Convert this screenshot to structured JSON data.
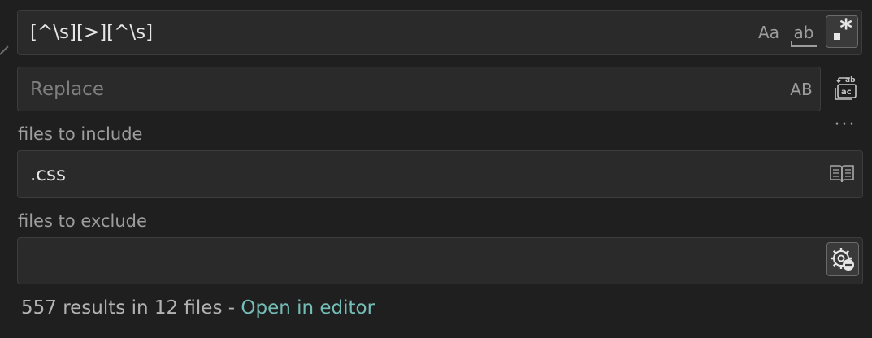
{
  "search": {
    "value": "[^\\s][>][^\\s]",
    "match_case_label": "Aa",
    "match_whole_word_label": "ab",
    "regex_icon": "regex-icon"
  },
  "replace": {
    "placeholder": "Replace",
    "preserve_case_label": "AB",
    "replace_all_icon": "replace-all-icon"
  },
  "more_icon": "ellipsis-icon",
  "include": {
    "label": "files to include",
    "value": ".css",
    "open_editors_icon": "book-icon"
  },
  "exclude": {
    "label": "files to exclude",
    "value": "",
    "settings_icon": "gear-exclude-icon"
  },
  "results": {
    "summary": "557 results in 12 files - ",
    "open_link": "Open in editor"
  },
  "colors": {
    "background": "#1f1f1f",
    "field": "#2a2a2a",
    "link": "#75beb8"
  }
}
